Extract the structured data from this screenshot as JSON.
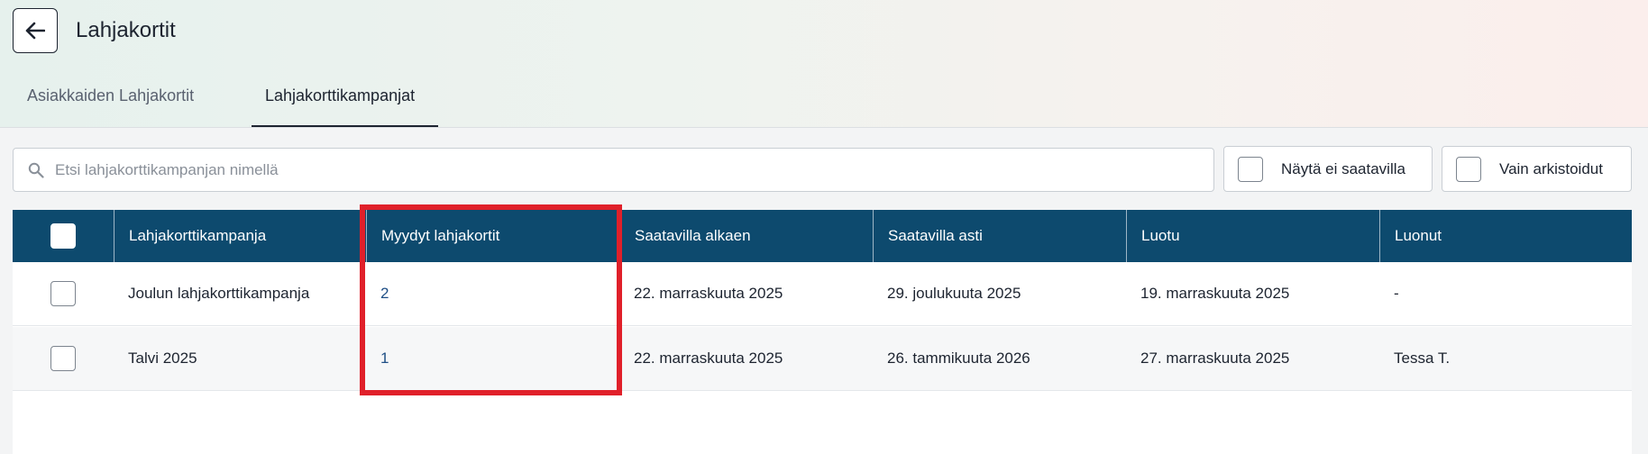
{
  "header": {
    "title": "Lahjakortit",
    "back_icon": "arrow-left-icon"
  },
  "tabs": [
    {
      "label": "Asiakkaiden Lahjakortit",
      "active": false
    },
    {
      "label": "Lahjakorttikampanjat",
      "active": true
    }
  ],
  "search": {
    "placeholder": "Etsi lahjakorttikampanjan nimellä",
    "value": "",
    "icon": "search-icon"
  },
  "filters": {
    "show_unavailable_label": "Näytä ei saatavilla",
    "show_unavailable_checked": false,
    "archived_only_label": "Vain arkistoidut",
    "archived_only_checked": false
  },
  "table": {
    "columns": [
      "Lahjakorttikampanja",
      "Myydyt lahjakortit",
      "Saatavilla alkaen",
      "Saatavilla asti",
      "Luotu",
      "Luonut"
    ],
    "rows": [
      {
        "name": "Joulun lahjakorttikampanja",
        "sold": "2",
        "available_from": "22. marraskuuta 2025",
        "available_until": "29. joulukuuta 2025",
        "created": "19. marraskuuta 2025",
        "created_by": "-"
      },
      {
        "name": "Talvi 2025",
        "sold": "1",
        "available_from": "22. marraskuuta 2025",
        "available_until": "26. tammikuuta 2026",
        "created": "27. marraskuuta 2025",
        "created_by": "Tessa T."
      }
    ]
  },
  "colors": {
    "table_header": "#0d4a6e",
    "highlight": "#e0202a",
    "link": "#1f4f86"
  }
}
